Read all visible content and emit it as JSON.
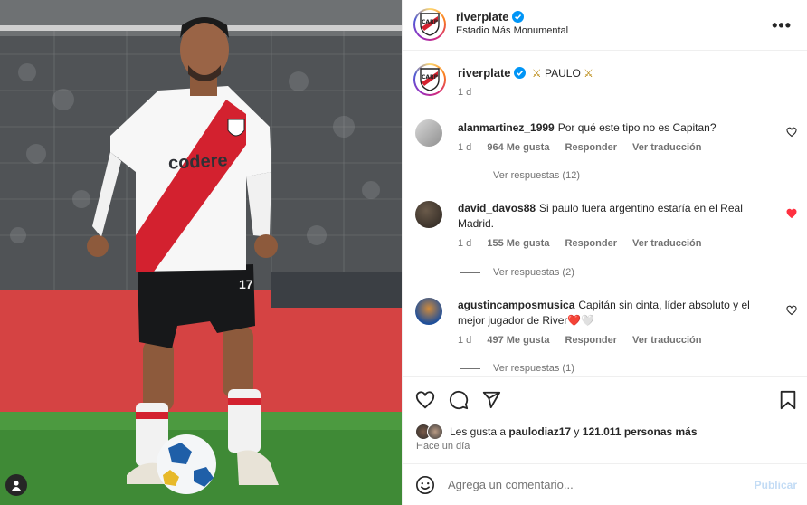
{
  "post": {
    "username": "riverplate",
    "location": "Estadio Más Monumental",
    "caption_text": "PAULO",
    "caption_emoji_left": "⚔",
    "caption_emoji_right": "⚔",
    "caption_time": "1 d",
    "verified": true
  },
  "comments": [
    {
      "user": "alanmartinez_1999",
      "text": "Por qué este tipo no es Capitan?",
      "time": "1 d",
      "likes": "964 Me gusta",
      "reply": "Responder",
      "translate": "Ver traducción",
      "view_replies": "Ver respuestas (12)",
      "liked": false
    },
    {
      "user": "david_davos88",
      "text": "Si paulo fuera argentino estaría en el Real Madrid.",
      "time": "1 d",
      "likes": "155 Me gusta",
      "reply": "Responder",
      "translate": "Ver traducción",
      "view_replies": "Ver respuestas (2)",
      "liked": true
    },
    {
      "user": "agustincamposmusica",
      "text": "Capitán sin cinta, líder absoluto y el mejor jugador de River❤️🤍",
      "time": "1 d",
      "likes": "497 Me gusta",
      "reply": "Responder",
      "translate": "Ver traducción",
      "view_replies": "Ver respuestas (1)",
      "liked": false
    }
  ],
  "likes": {
    "prefix": "Les gusta a",
    "first_user": "paulodiaz17",
    "connector": "y",
    "others": "121.011 personas más"
  },
  "posted_ago": "Hace un día",
  "composer": {
    "placeholder": "Agrega un comentario...",
    "publish_label": "Publicar"
  },
  "photo": {
    "sponsor_text": "codere",
    "shirt_number": "17"
  },
  "colors": {
    "like_red": "#ff3040",
    "river_red": "#d3212f",
    "publish_disabled": "#c3dcf5",
    "muted_text": "#737373"
  },
  "icons": [
    "heart-icon",
    "comment-icon",
    "share-icon",
    "bookmark-icon",
    "emoji-icon",
    "more-icon",
    "verified-icon",
    "tag-user-icon"
  ]
}
